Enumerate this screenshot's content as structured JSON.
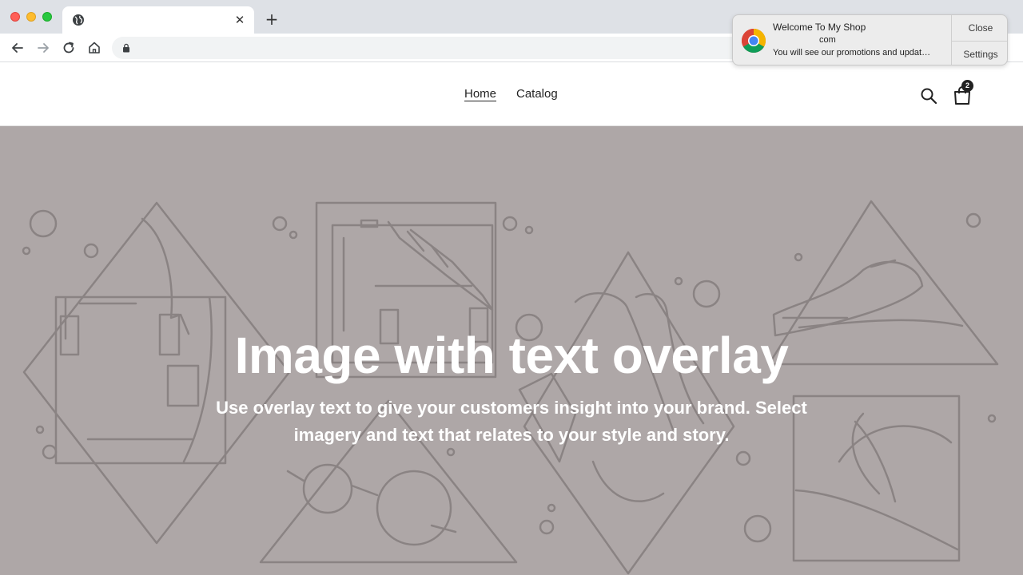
{
  "browser": {
    "tab_title": "",
    "close_tab_glyph": "✕",
    "new_tab_glyph": "+",
    "url": ""
  },
  "shop": {
    "nav": [
      {
        "label": "Home",
        "active": true
      },
      {
        "label": "Catalog",
        "active": false
      }
    ],
    "cart_count": "2"
  },
  "hero": {
    "heading": "Image with text overlay",
    "subtext": "Use overlay text to give your customers insight into your brand. Select imagery and text that relates to your style and story.",
    "background_color": "#aea7a7",
    "line_color": "#8a8383"
  },
  "notification": {
    "title": "Welcome To My Shop",
    "site": "com",
    "body": "You will see our promotions and updat…",
    "close_label": "Close",
    "settings_label": "Settings"
  },
  "colors": {
    "tabbar": "#dee1e6",
    "text": "#222222"
  }
}
